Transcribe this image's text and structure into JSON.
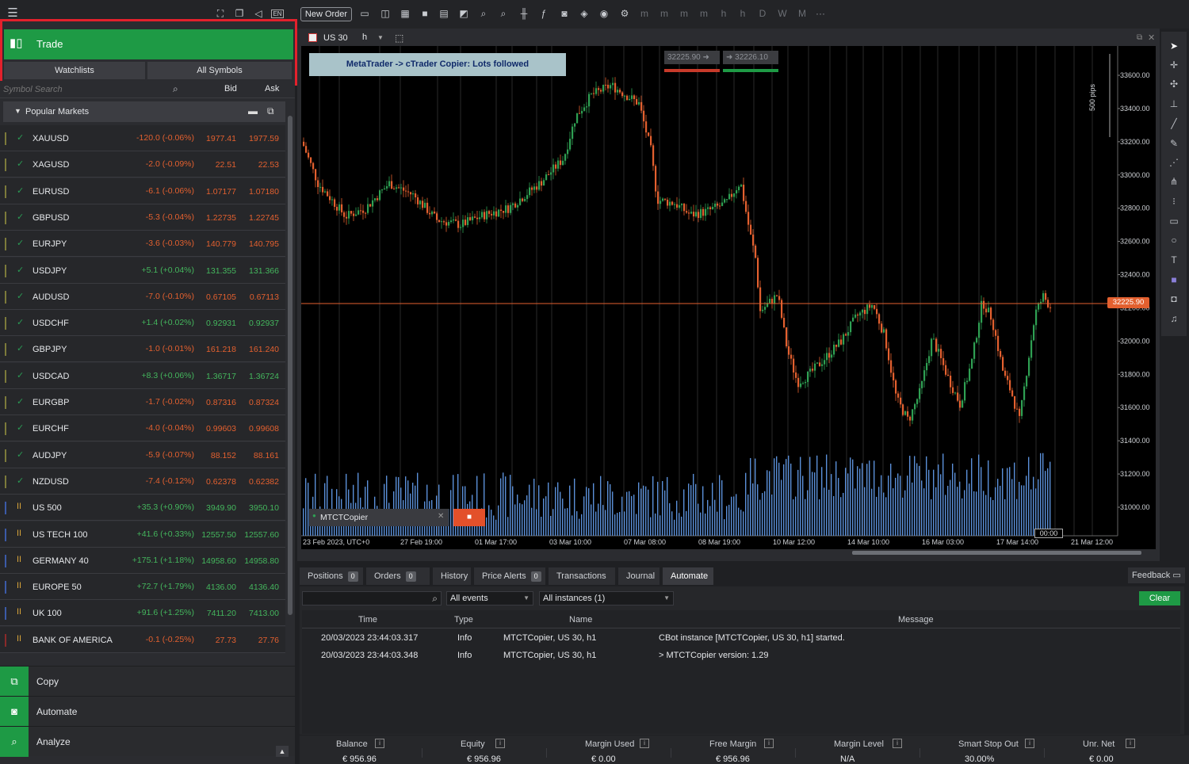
{
  "toolbar": {
    "new_order": "New Order",
    "timeframes": [
      "m",
      "m",
      "m",
      "m",
      "h",
      "h",
      "D",
      "W",
      "M"
    ],
    "more": "···"
  },
  "left": {
    "trade_label": "Trade",
    "tabs": [
      "Watchlists",
      "All Symbols"
    ],
    "search_placeholder": "Symbol Search",
    "col_bid": "Bid",
    "col_ask": "Ask",
    "section": "Popular Markets",
    "symbols": [
      {
        "name": "XAUUSD",
        "change": "-120.0 (-0.06%)",
        "dir": "neg",
        "bid": "1977.41",
        "ask": "1977.59",
        "kind": "fx"
      },
      {
        "name": "XAGUSD",
        "change": "-2.0 (-0.09%)",
        "dir": "neg",
        "bid": "22.51",
        "ask": "22.53",
        "kind": "fx"
      },
      {
        "name": "EURUSD",
        "change": "-6.1 (-0.06%)",
        "dir": "neg",
        "bid": "1.07177",
        "ask": "1.07180",
        "kind": "fx"
      },
      {
        "name": "GBPUSD",
        "change": "-5.3 (-0.04%)",
        "dir": "neg",
        "bid": "1.22735",
        "ask": "1.22745",
        "kind": "fx"
      },
      {
        "name": "EURJPY",
        "change": "-3.6 (-0.03%)",
        "dir": "neg",
        "bid": "140.779",
        "ask": "140.795",
        "kind": "fx"
      },
      {
        "name": "USDJPY",
        "change": "+5.1 (+0.04%)",
        "dir": "pos",
        "bid": "131.355",
        "ask": "131.366",
        "kind": "fx"
      },
      {
        "name": "AUDUSD",
        "change": "-7.0 (-0.10%)",
        "dir": "neg",
        "bid": "0.67105",
        "ask": "0.67113",
        "kind": "fx"
      },
      {
        "name": "USDCHF",
        "change": "+1.4 (+0.02%)",
        "dir": "pos",
        "bid": "0.92931",
        "ask": "0.92937",
        "kind": "fx"
      },
      {
        "name": "GBPJPY",
        "change": "-1.0 (-0.01%)",
        "dir": "neg",
        "bid": "161.218",
        "ask": "161.240",
        "kind": "fx"
      },
      {
        "name": "USDCAD",
        "change": "+8.3 (+0.06%)",
        "dir": "pos",
        "bid": "1.36717",
        "ask": "1.36724",
        "kind": "fx"
      },
      {
        "name": "EURGBP",
        "change": "-1.7 (-0.02%)",
        "dir": "neg",
        "bid": "0.87316",
        "ask": "0.87324",
        "kind": "fx"
      },
      {
        "name": "EURCHF",
        "change": "-4.0 (-0.04%)",
        "dir": "neg",
        "bid": "0.99603",
        "ask": "0.99608",
        "kind": "fx"
      },
      {
        "name": "AUDJPY",
        "change": "-5.9 (-0.07%)",
        "dir": "neg",
        "bid": "88.152",
        "ask": "88.161",
        "kind": "fx"
      },
      {
        "name": "NZDUSD",
        "change": "-7.4 (-0.12%)",
        "dir": "neg",
        "bid": "0.62378",
        "ask": "0.62382",
        "kind": "fx"
      },
      {
        "name": "US 500",
        "change": "+35.3 (+0.90%)",
        "dir": "pos",
        "bid": "3949.90",
        "ask": "3950.10",
        "kind": "idx"
      },
      {
        "name": "US TECH 100",
        "change": "+41.6 (+0.33%)",
        "dir": "pos",
        "bid": "12557.50",
        "ask": "12557.60",
        "kind": "idx"
      },
      {
        "name": "GERMANY 40",
        "change": "+175.1 (+1.18%)",
        "dir": "pos",
        "bid": "14958.60",
        "ask": "14958.80",
        "kind": "idx"
      },
      {
        "name": "EUROPE 50",
        "change": "+72.7 (+1.79%)",
        "dir": "pos",
        "bid": "4136.00",
        "ask": "4136.40",
        "kind": "idx"
      },
      {
        "name": "UK 100",
        "change": "+91.6 (+1.25%)",
        "dir": "pos",
        "bid": "7411.20",
        "ask": "7413.00",
        "kind": "idx"
      },
      {
        "name": "BANK OF AMERICA",
        "change": "-0.1 (-0.25%)",
        "dir": "neg",
        "bid": "27.73",
        "ask": "27.76",
        "kind": "stk"
      }
    ],
    "bottom_nav": [
      "Copy",
      "Automate",
      "Analyze"
    ]
  },
  "chart": {
    "symbol": "US 30",
    "timeframe": "h",
    "banner": "MetaTrader -> cTrader Copier: Lots followed",
    "sell_price": "32225.90",
    "buy_price": "32226.10",
    "price_label": "32225.90",
    "pips_label": "500 pips",
    "cbot_name": "MTCTCopier",
    "countdown": "00:00",
    "y_ticks": [
      "33600.00",
      "33400.00",
      "33200.00",
      "33000.00",
      "32800.00",
      "32600.00",
      "32400.00",
      "32200.00",
      "32000.00",
      "31800.00",
      "31600.00",
      "31400.00",
      "31200.00",
      "31000.00"
    ],
    "x_ticks": [
      "23 Feb 2023, UTC+0",
      "27 Feb 19:00",
      "01 Mar 17:00",
      "03 Mar 10:00",
      "07 Mar 08:00",
      "08 Mar 19:00",
      "10 Mar 12:00",
      "14 Mar 10:00",
      "16 Mar 03:00",
      "17 Mar 14:00",
      "21 Mar 12:00"
    ]
  },
  "bottom": {
    "tabs": [
      {
        "label": "Positions",
        "count": "0"
      },
      {
        "label": "Orders",
        "count": "0"
      },
      {
        "label": "History",
        "count": null
      },
      {
        "label": "Price Alerts",
        "count": "0"
      },
      {
        "label": "Transactions",
        "count": null
      },
      {
        "label": "Journal",
        "count": null
      },
      {
        "label": "Automate",
        "count": null
      }
    ],
    "feedback": "Feedback",
    "filter_events": "All events",
    "filter_instances": "All instances (1)",
    "clear": "Clear",
    "headers": [
      "Time",
      "Type",
      "Name",
      "Message"
    ],
    "rows": [
      {
        "time": "20/03/2023 23:44:03.317",
        "type": "Info",
        "name": "MTCTCopier, US 30, h1",
        "message": "CBot instance [MTCTCopier, US 30, h1] started."
      },
      {
        "time": "20/03/2023 23:44:03.348",
        "type": "Info",
        "name": "MTCTCopier, US 30, h1",
        "message": ">  MTCTCopier version: 1.29"
      }
    ],
    "status": [
      {
        "label": "Balance",
        "value": "€ 956.96"
      },
      {
        "label": "Equity",
        "value": "€ 956.96"
      },
      {
        "label": "Margin Used",
        "value": "€ 0.00"
      },
      {
        "label": "Free Margin",
        "value": "€ 956.96"
      },
      {
        "label": "Margin Level",
        "value": "N/A"
      },
      {
        "label": "Smart Stop Out",
        "value": "30.00%"
      },
      {
        "label": "Unr. Net",
        "value": "€ 0.00"
      }
    ]
  },
  "colors": {
    "accent": "#1e9a45",
    "highlight": "#e3212c",
    "bull": "#2fa053",
    "bear": "#e3602f",
    "volume": "#5b8fd8"
  }
}
